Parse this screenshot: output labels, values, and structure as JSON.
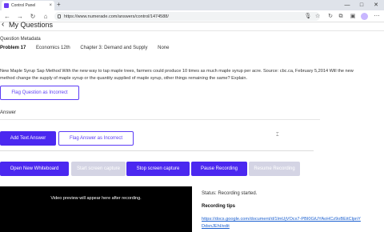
{
  "browser": {
    "tab_title": "Control Panel",
    "tab_close": "×",
    "new_tab": "+",
    "url": "https://www.numerade.com/answers/control/1474588/",
    "window_controls": [
      "—",
      "□",
      "✕"
    ],
    "toolbar_icons": [
      "microphone-icon",
      "star-icon",
      "refresh-icon",
      "extensions-icon",
      "collections-icon",
      "profile-icon",
      "more-icon"
    ]
  },
  "header": {
    "back": "‹",
    "title": "My Questions"
  },
  "metadata": {
    "label": "Question Metadata",
    "problem": "Problem 17",
    "subject": "Economics 12th",
    "chapter": "Chapter 3: Demand and Supply",
    "section": "None"
  },
  "question": {
    "line1": "New Maple Syrup Sap Method With the new way to tap maple trees, farmers could produce 10 times as much maple syrup per acre. Source: cbc.ca, February 5,2014 Will the new",
    "line2": "method change the supply of maple syrup or the quantity supplied of maple syrup, other things remaining the same? Explain."
  },
  "buttons": {
    "flag_question": "Flag Question as Incorrect",
    "add_text_answer": "Add Text Answer",
    "flag_answer": "Flag Answer as Incorrect",
    "open_whiteboard": "Open New Whiteboard",
    "start_capture": "Start screen capture",
    "stop_capture": "Stop screen capture",
    "pause_recording": "Pause Recording",
    "resume_recording": "Resume Recording"
  },
  "answer": {
    "label": "Answer"
  },
  "video": {
    "placeholder": "Video preview will appear here after recording."
  },
  "recording": {
    "status": "Status: Recording started.",
    "tips_title": "Recording tips",
    "tips_link": "https://docs.google.com/document/d/1lmUjVOcx7-PBI0GiUYAoHCz9oBEitClpnYDdsnJEhI/edit"
  },
  "colors": {
    "accent": "#4b28f0",
    "accent_outline": "#5b3cf5",
    "disabled": "#d4d4e4",
    "link": "#1a5fd0"
  }
}
